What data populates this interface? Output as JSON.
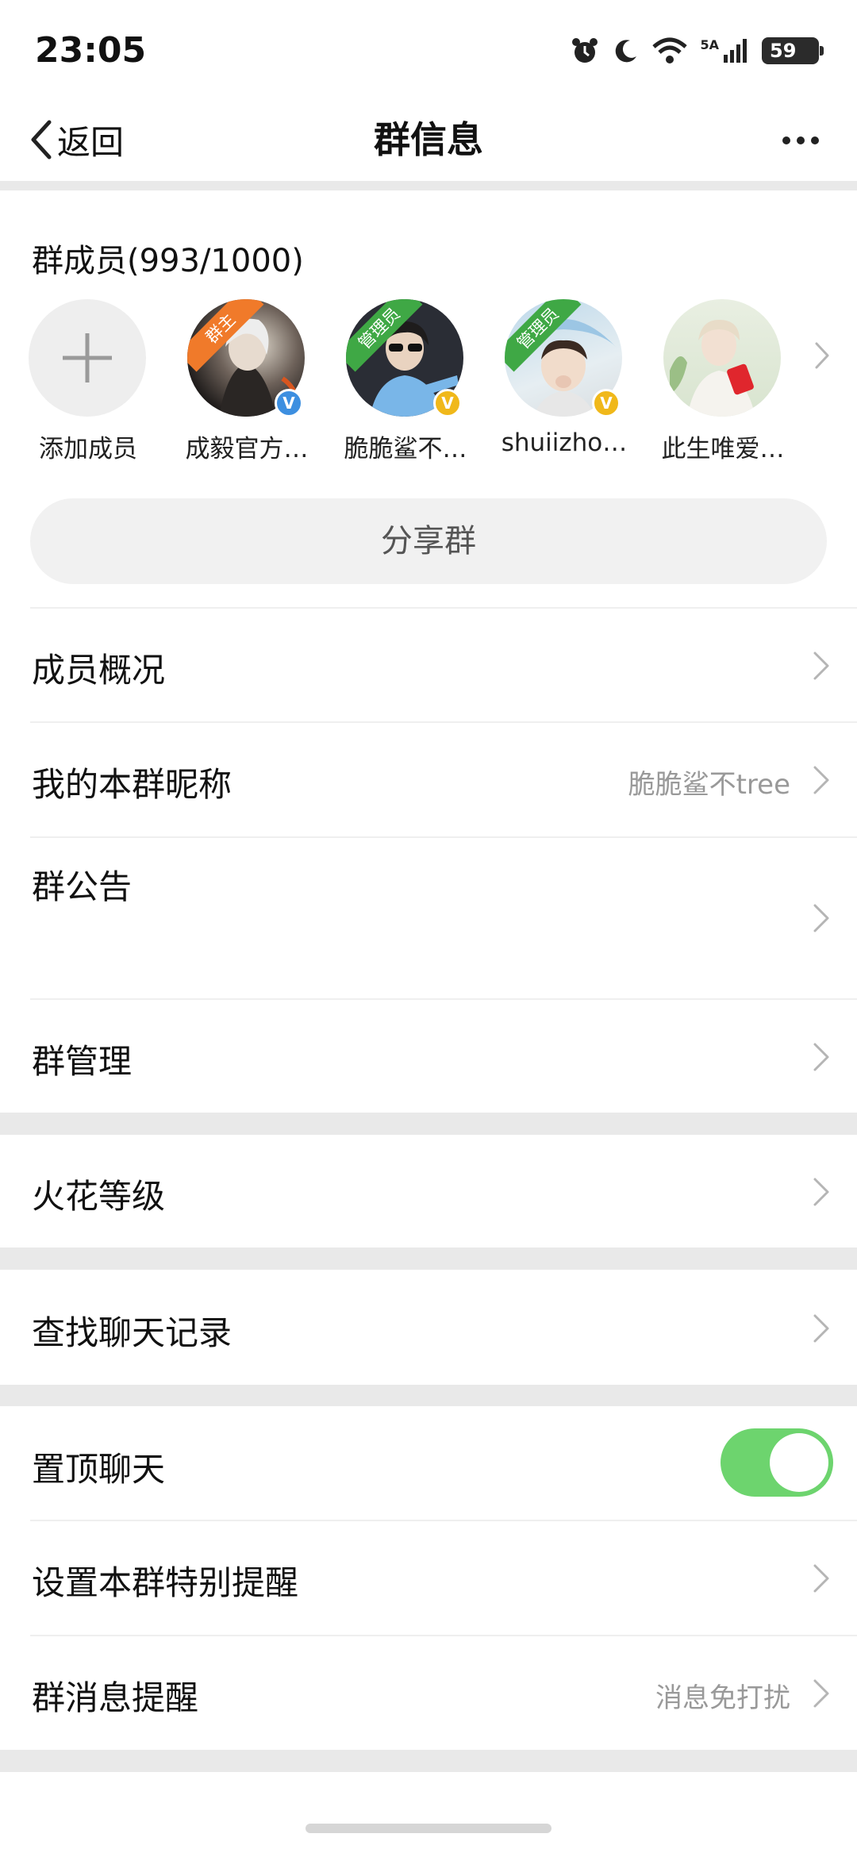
{
  "status_bar": {
    "time": "23:05",
    "network": "5A",
    "battery": "59"
  },
  "nav": {
    "back_label": "返回",
    "title": "群信息"
  },
  "members": {
    "title": "群成员(993/1000)",
    "add_label": "添加成员",
    "list": [
      {
        "name": "成毅官方…",
        "role": "群主",
        "role_color": "#f07a2a",
        "verify_color": "#3d8fe0"
      },
      {
        "name": "脆脆鲨不…",
        "role": "管理员",
        "role_color": "#3fa845",
        "verify_color": "#f0b81a"
      },
      {
        "name": "shuiizho…",
        "role": "管理员",
        "role_color": "#3fa845",
        "verify_color": "#f0b81a"
      },
      {
        "name": "此生唯爱…",
        "role": "",
        "role_color": "",
        "verify_color": ""
      }
    ],
    "share_label": "分享群"
  },
  "rows": {
    "overview": "成员概况",
    "nickname_label": "我的本群昵称",
    "nickname_value": "脆脆鲨不tree",
    "announcement": "群公告",
    "management": "群管理",
    "spark_level": "火花等级",
    "search_history": "查找聊天记录",
    "pin_chat": "置顶聊天",
    "special_reminder": "设置本群特别提醒",
    "msg_reminder_label": "群消息提醒",
    "msg_reminder_value": "消息免打扰"
  },
  "pin_chat_on": true,
  "colors": {
    "toggle_on": "#6dd46e",
    "section_gap": "#e9e9e9"
  }
}
